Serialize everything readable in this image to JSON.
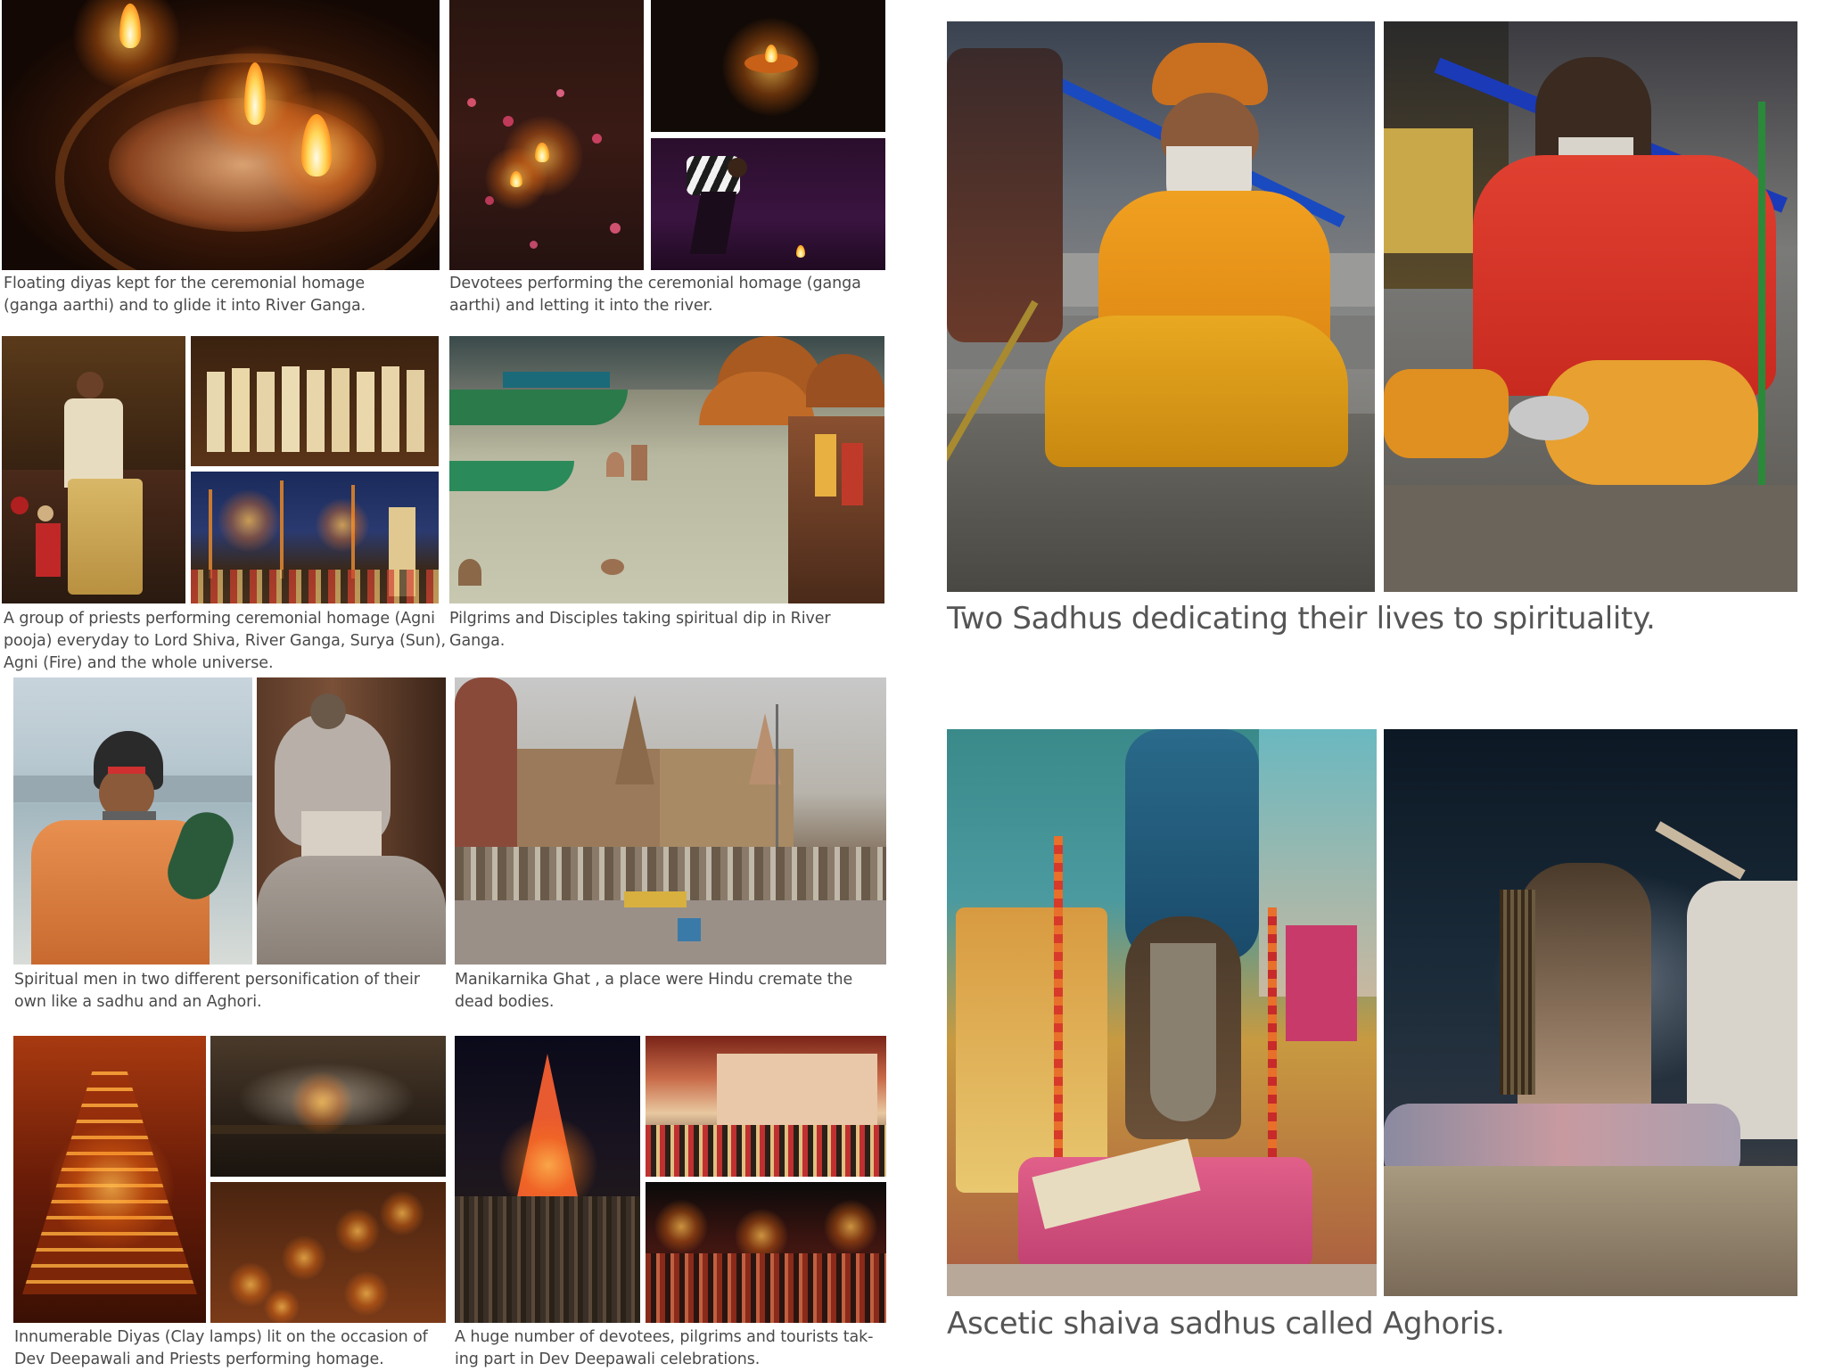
{
  "captions": {
    "floating_diyas": "Floating diyas kept for the ceremonial homage\n(ganga aarthi) and to glide it into River Ganga.",
    "devotees_homage": "Devotees performing the ceremonial homage (ganga\naarthi) and letting it into the river.",
    "priests_pooja": "A group of priests performing ceremonial homage (Agni\npooja) everyday to Lord Shiva, River Ganga, Surya (Sun),\nAgni (Fire) and the whole universe.",
    "pilgrims_dip": "Pilgrims and Disciples taking spiritual dip in River\nGanga.",
    "spiritual_men": "Spiritual men in two different personification of their\nown like a sadhu and an Aghori.",
    "manikarnika": "Manikarnika Ghat , a place were Hindu cremate the\ndead bodies.",
    "diyas_deepawali": "Innumerable Diyas (Clay lamps) lit on the occasion of\nDev Deepawali and Priests performing homage.",
    "devotees_deepawali": "A huge number of devotees, pilgrims and tourists tak-\ning part in Dev Deepawali celebrations.",
    "two_sadhus": "Two Sadhus dedicating their lives to spirituality.",
    "aghoris": "Ascetic shaiva sadhus called Aghoris."
  }
}
